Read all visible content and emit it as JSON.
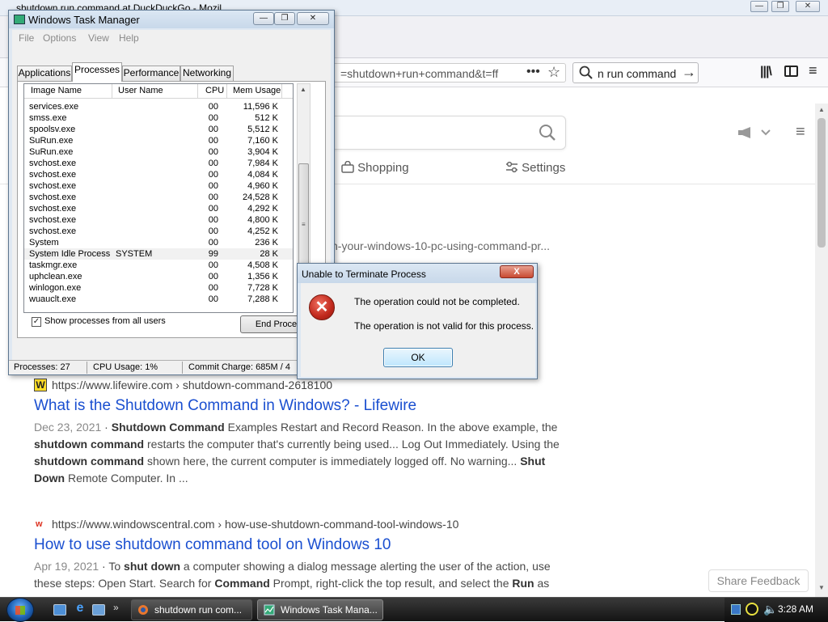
{
  "firefox": {
    "window_title": "shutdown run command at DuckDuckGo - Mozil",
    "url_partial": "=shutdown+run+command&t=ff",
    "url_more": "•••",
    "search_box_text": "n run command",
    "min_glyph": "—",
    "max_glyph": "❐",
    "close_glyph": "✕",
    "menu_glyph": "≡",
    "library_glyph": "|||\\",
    "search_go_glyph": "→",
    "star_glyph": "☆"
  },
  "ddg": {
    "tab_shopping": "Shopping",
    "tab_settings": "Settings",
    "partial_result_url": "n-your-windows-10-pc-using-command-pr...",
    "results": [
      {
        "favicon": "W",
        "url": "https://www.lifewire.com › shutdown-command-2618100",
        "title": "What is the Shutdown Command in Windows? - Lifewire",
        "date": "Dec 23, 2021",
        "snippet_parts": [
          {
            "bold": false,
            "text": " · "
          },
          {
            "bold": true,
            "text": "Shutdown Command"
          },
          {
            "bold": false,
            "text": " Examples Restart and Record Reason. In the above example, the "
          },
          {
            "bold": true,
            "text": "shutdown command"
          },
          {
            "bold": false,
            "text": " restarts the computer that's currently being used... Log Out Immediately. Using the "
          },
          {
            "bold": true,
            "text": "shutdown command"
          },
          {
            "bold": false,
            "text": " shown here, the current computer is immediately logged off. No warning... "
          },
          {
            "bold": true,
            "text": "Shut Down"
          },
          {
            "bold": false,
            "text": " Remote Computer. In ..."
          }
        ]
      },
      {
        "favicon": "w",
        "url": "https://www.windowscentral.com › how-use-shutdown-command-tool-windows-10",
        "title": "How to use shutdown command tool on Windows 10",
        "date": "Apr 19, 2021",
        "snippet_parts": [
          {
            "bold": false,
            "text": " · To "
          },
          {
            "bold": true,
            "text": "shut down"
          },
          {
            "bold": false,
            "text": " a computer showing a dialog message alerting the user of the action, use these steps: Open Start. Search for "
          },
          {
            "bold": true,
            "text": "Command"
          },
          {
            "bold": false,
            "text": " Prompt, right-click the top result, and select the "
          },
          {
            "bold": true,
            "text": "Run"
          },
          {
            "bold": false,
            "text": " as"
          }
        ]
      }
    ],
    "share_feedback": "Share Feedback"
  },
  "task_manager": {
    "title": "Windows Task Manager",
    "menu": [
      "File",
      "Options",
      "View",
      "Help"
    ],
    "tabs": [
      "Applications",
      "Processes",
      "Performance",
      "Networking"
    ],
    "active_tab": "Processes",
    "columns": [
      "Image Name",
      "User Name",
      "CPU",
      "Mem Usage"
    ],
    "rows": [
      {
        "name": "services.exe",
        "user": "",
        "cpu": "00",
        "mem": "11,596 K"
      },
      {
        "name": "smss.exe",
        "user": "",
        "cpu": "00",
        "mem": "512 K"
      },
      {
        "name": "spoolsv.exe",
        "user": "",
        "cpu": "00",
        "mem": "5,512 K"
      },
      {
        "name": "SuRun.exe",
        "user": "",
        "cpu": "00",
        "mem": "7,160 K"
      },
      {
        "name": "SuRun.exe",
        "user": "",
        "cpu": "00",
        "mem": "3,904 K"
      },
      {
        "name": "svchost.exe",
        "user": "",
        "cpu": "00",
        "mem": "7,984 K"
      },
      {
        "name": "svchost.exe",
        "user": "",
        "cpu": "00",
        "mem": "4,084 K"
      },
      {
        "name": "svchost.exe",
        "user": "",
        "cpu": "00",
        "mem": "4,960 K"
      },
      {
        "name": "svchost.exe",
        "user": "",
        "cpu": "00",
        "mem": "24,528 K"
      },
      {
        "name": "svchost.exe",
        "user": "",
        "cpu": "00",
        "mem": "4,292 K"
      },
      {
        "name": "svchost.exe",
        "user": "",
        "cpu": "00",
        "mem": "4,800 K"
      },
      {
        "name": "svchost.exe",
        "user": "",
        "cpu": "00",
        "mem": "4,252 K"
      },
      {
        "name": "System",
        "user": "",
        "cpu": "00",
        "mem": "236 K"
      },
      {
        "name": "System Idle Process",
        "user": "SYSTEM",
        "cpu": "99",
        "mem": "28 K",
        "selected": true
      },
      {
        "name": "taskmgr.exe",
        "user": "",
        "cpu": "00",
        "mem": "4,508 K"
      },
      {
        "name": "uphclean.exe",
        "user": "",
        "cpu": "00",
        "mem": "1,356 K"
      },
      {
        "name": "winlogon.exe",
        "user": "",
        "cpu": "00",
        "mem": "7,728 K"
      },
      {
        "name": "wuauclt.exe",
        "user": "",
        "cpu": "00",
        "mem": "7,288 K"
      }
    ],
    "show_all_label": "Show processes from all users",
    "show_all_checked": true,
    "end_process_label": "End Process",
    "status": {
      "processes": "Processes: 27",
      "cpu": "CPU Usage: 1%",
      "commit": "Commit Charge: 685M / 4"
    }
  },
  "dialog": {
    "title": "Unable to Terminate Process",
    "close_label": "X",
    "message1": "The operation could not be completed.",
    "message2": "The operation is not valid for this process.",
    "ok_label": "OK",
    "icon_glyph": "✕"
  },
  "taskbar": {
    "tasks": [
      {
        "label": "shutdown run com...",
        "active": false
      },
      {
        "label": "Windows Task Mana...",
        "active": true
      }
    ],
    "ql_more": "»",
    "clock": "3:28 AM"
  }
}
